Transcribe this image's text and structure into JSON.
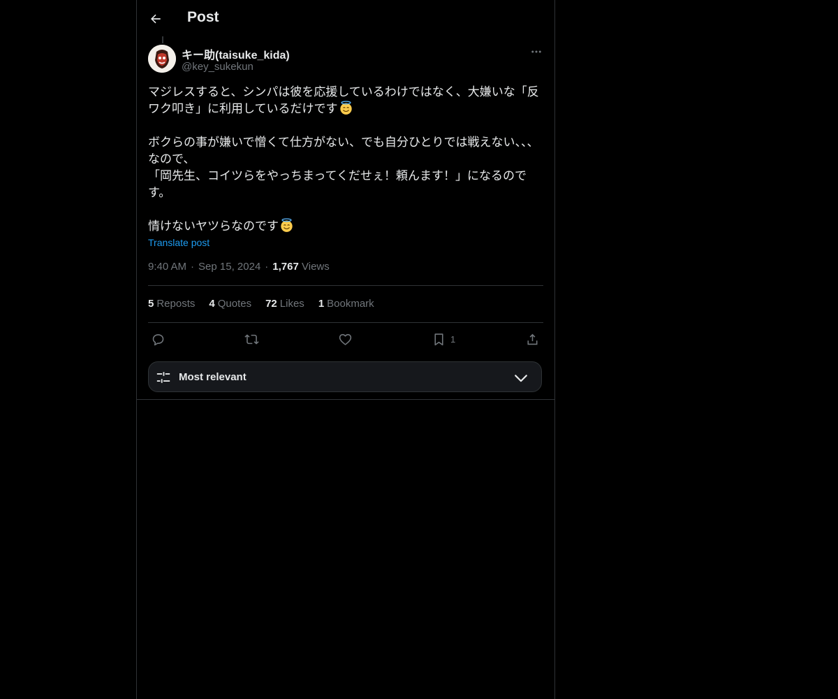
{
  "header": {
    "title": "Post"
  },
  "author": {
    "name": "キー助(taisuke_kida)",
    "handle": "@key_sukekun"
  },
  "post": {
    "paragraphs": [
      "マジレスすると、シンパは彼を応援しているわけではなく、大嫌いな「反ワク叩き」に利用しているだけです",
      "ボクらの事が嫌いで憎くて仕方がない、でも自分ひとりでは戦えない、、、\nなので、\n「岡先生、コイツらをやっちまってくだせぇ！頼んます！」になるのです。",
      "情けないヤツらなのです"
    ],
    "translate_label": "Translate post"
  },
  "meta": {
    "time": "9:40 AM",
    "date": "Sep 15, 2024",
    "views_count": "1,767",
    "views_label": "Views"
  },
  "stats": {
    "reposts_count": "5",
    "reposts_label": "Reposts",
    "quotes_count": "4",
    "quotes_label": "Quotes",
    "likes_count": "72",
    "likes_label": "Likes",
    "bookmarks_count": "1",
    "bookmarks_label": "Bookmark"
  },
  "actions": {
    "bookmark_count": "1"
  },
  "sort": {
    "label": "Most relevant"
  },
  "icons": {
    "back": "arrow-left-icon",
    "more": "more-horizontal-icon",
    "reply": "reply-icon",
    "repost": "repost-icon",
    "like": "heart-icon",
    "bookmark": "bookmark-icon",
    "share": "share-icon",
    "sort": "sliders-icon",
    "chevron": "chevron-down-icon",
    "emoji": "smiling-face-with-halo-emoji"
  },
  "colors": {
    "background": "#000000",
    "text": "#e7e9ea",
    "muted": "#71767b",
    "link": "#1d9bf0",
    "border": "#2f3336"
  }
}
